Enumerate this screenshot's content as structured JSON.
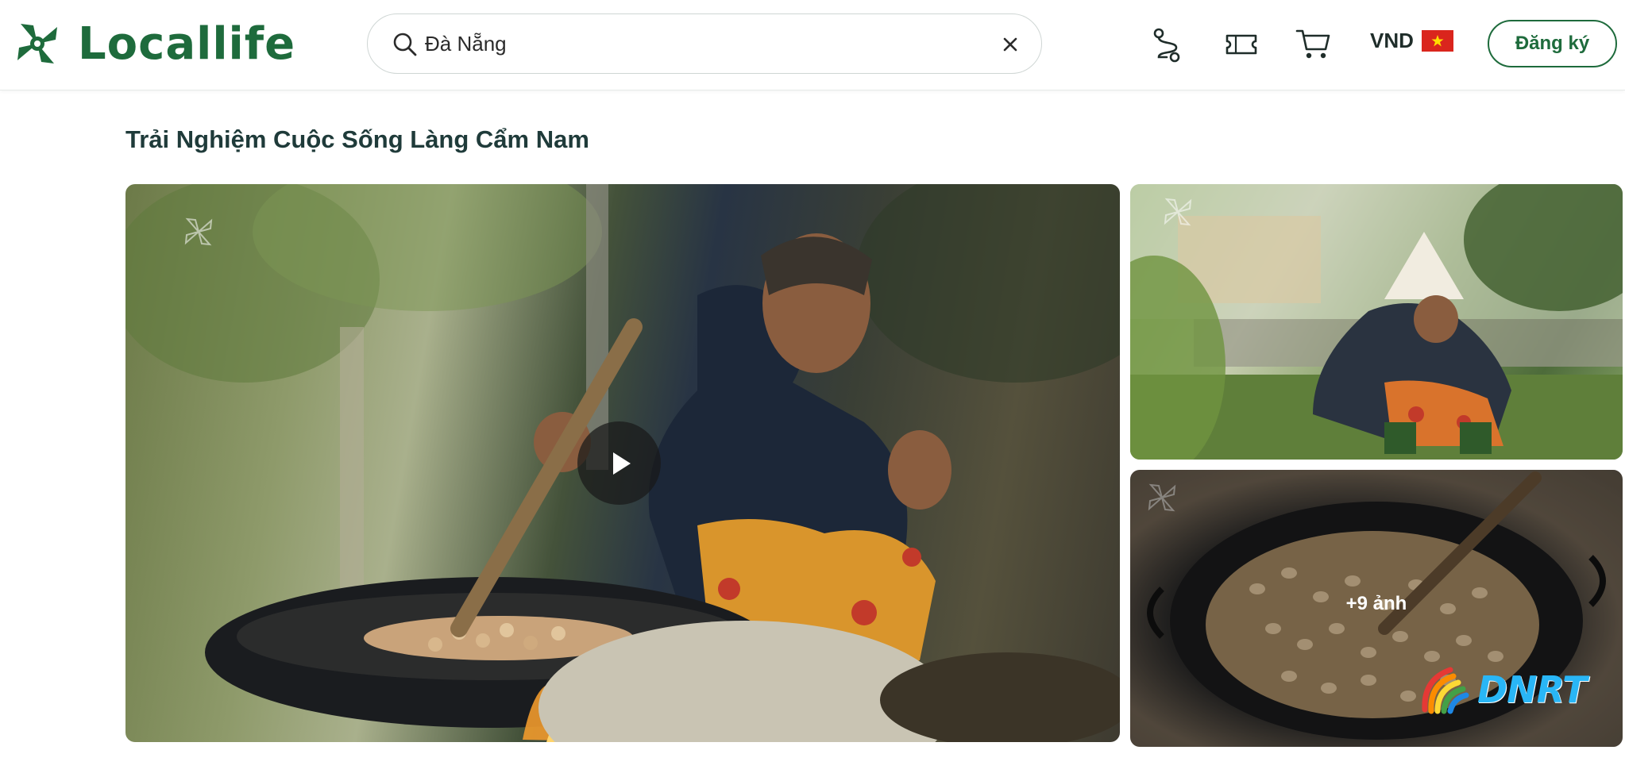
{
  "brand": {
    "name": "Locallife",
    "color": "#1e6b3c"
  },
  "search": {
    "value": "Đà Nẵng",
    "placeholder": ""
  },
  "header": {
    "icons": [
      "route-icon",
      "ticket-icon",
      "cart-icon"
    ],
    "currency": "VND",
    "flag": "vietnam-flag",
    "signup_label": "Đăng ký"
  },
  "page": {
    "title": "Trải Nghiệm Cuộc Sống Làng Cẩm Nam"
  },
  "gallery": {
    "main": {
      "type": "video"
    },
    "thumbnails": 2,
    "more_label": "+9 ảnh",
    "channel_logo": "DNRT"
  }
}
